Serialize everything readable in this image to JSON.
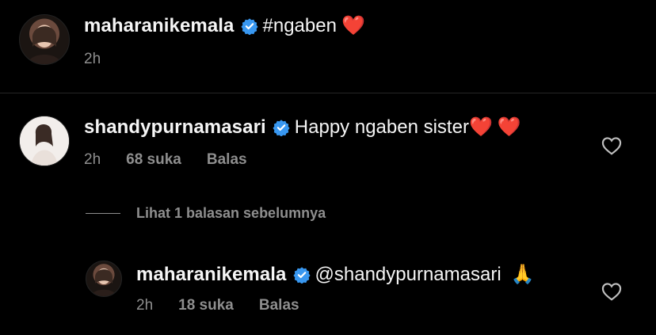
{
  "comments": [
    {
      "username": "maharanikemala",
      "text": "#ngaben ",
      "emoji": "❤️",
      "time": "2h"
    },
    {
      "username": "shandypurnamasari",
      "text": "Happy ngaben sister",
      "emoji": "❤️",
      "emoji2": "❤️",
      "time": "2h",
      "likes": "68 suka",
      "reply_label": "Balas"
    }
  ],
  "view_previous": "Lihat 1 balasan sebelumnya",
  "reply": {
    "username": "maharanikemala",
    "text": "@shandypurnamasari",
    "emoji": "🙏",
    "time": "2h",
    "likes": "18 suka",
    "reply_label": "Balas"
  },
  "colors": {
    "background": "#000000",
    "primary_text": "#f5f5f5",
    "secondary_text": "#8e8e8e",
    "verified": "#3897f0",
    "heart": "#e8262b"
  },
  "icons": [
    "verified-badge-icon",
    "heart-outline-icon"
  ]
}
